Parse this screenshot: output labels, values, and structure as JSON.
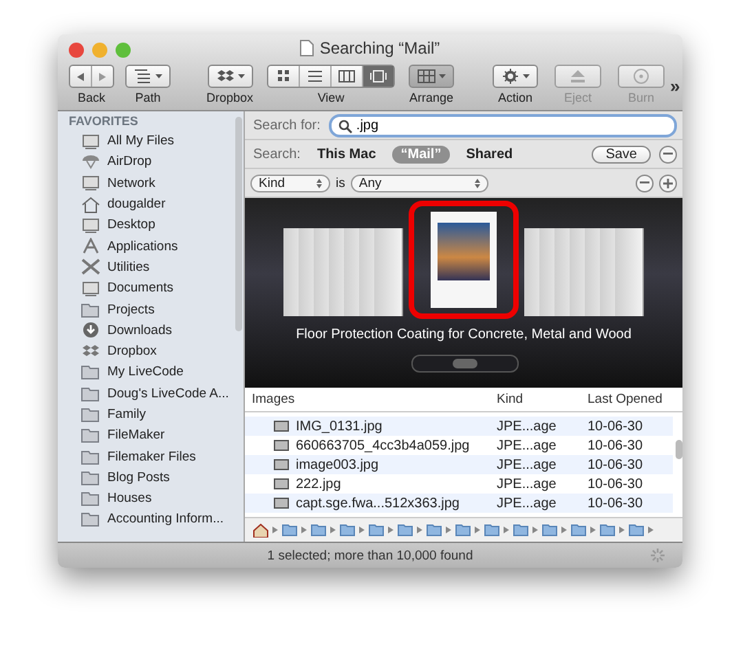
{
  "window": {
    "title": "Searching “Mail”"
  },
  "toolbar": [
    {
      "kind": "nav",
      "label": "Back",
      "disabled": false
    },
    {
      "kind": "path",
      "label": "Path",
      "disabled": false
    },
    {
      "kind": "dropbox",
      "label": "Dropbox",
      "disabled": false
    },
    {
      "kind": "view",
      "label": "View",
      "disabled": false
    },
    {
      "kind": "arrange",
      "label": "Arrange",
      "disabled": false
    },
    {
      "kind": "action",
      "label": "Action",
      "disabled": false
    },
    {
      "kind": "eject",
      "label": "Eject",
      "disabled": true
    },
    {
      "kind": "burn",
      "label": "Burn",
      "disabled": true
    }
  ],
  "view_modes": [
    {
      "selected": false
    },
    {
      "selected": false
    },
    {
      "selected": false
    },
    {
      "selected": true
    }
  ],
  "overflow": "»",
  "sidebar": {
    "heading": "FAVORITES",
    "items": [
      {
        "label": "All My Files"
      },
      {
        "label": "AirDrop"
      },
      {
        "label": "Network"
      },
      {
        "label": "dougalder"
      },
      {
        "label": "Desktop"
      },
      {
        "label": "Applications"
      },
      {
        "label": "Utilities"
      },
      {
        "label": "Documents"
      },
      {
        "label": "Projects"
      },
      {
        "label": "Downloads"
      },
      {
        "label": "Dropbox"
      },
      {
        "label": "My LiveCode"
      },
      {
        "label": "Doug's LiveCode A..."
      },
      {
        "label": "Family"
      },
      {
        "label": "FileMaker"
      },
      {
        "label": "Filemaker Files"
      },
      {
        "label": "Blog Posts"
      },
      {
        "label": "Houses"
      },
      {
        "label": "Accounting Inform..."
      }
    ]
  },
  "search": {
    "label": "Search for:",
    "value": ".jpg"
  },
  "scope": {
    "label": "Search:",
    "options": [
      {
        "label": "This Mac",
        "selected": false
      },
      {
        "label": "“Mail”",
        "selected": true
      },
      {
        "label": "Shared",
        "selected": false
      }
    ],
    "save": "Save"
  },
  "criteria": {
    "attribute": "Kind",
    "operator": "is",
    "value": "Any"
  },
  "coverflow": {
    "caption": "Floor Protection Coating for Concrete, Metal and Wood"
  },
  "table": {
    "columns": [
      "Images",
      "Kind",
      "Last Opened"
    ],
    "rows": [
      {
        "name": "IMG_0131.jpg",
        "kind": "JPE...age",
        "opened": "10-06-30"
      },
      {
        "name": "660663705_4cc3b4a059.jpg",
        "kind": "JPE...age",
        "opened": "10-06-30"
      },
      {
        "name": "image003.jpg",
        "kind": "JPE...age",
        "opened": "10-06-30"
      },
      {
        "name": "222.jpg",
        "kind": "JPE...age",
        "opened": "10-06-30"
      },
      {
        "name": "capt.sge.fwa...512x363.jpg",
        "kind": "JPE...age",
        "opened": "10-06-30"
      }
    ]
  },
  "status_bar": "1 selected; more than 10,000 found"
}
